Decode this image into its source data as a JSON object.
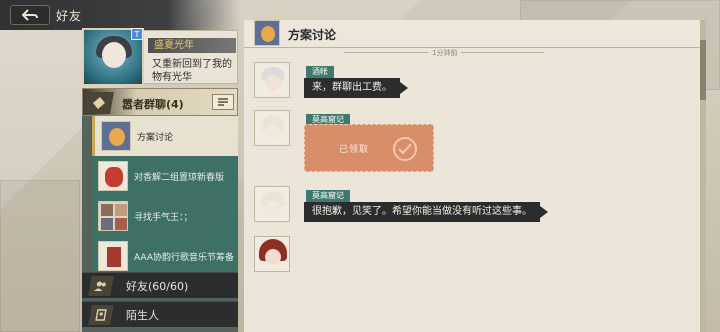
{
  "topbar": {
    "title": "好友",
    "back_icon": "back-arrow-icon"
  },
  "profile": {
    "level_badge": "T",
    "name": "盛夏光年",
    "signature": "又重新回到了我的物有光华"
  },
  "group": {
    "label": "嚣者群聊(4)"
  },
  "chat_list": [
    {
      "label": "方案讨论",
      "active": true
    },
    {
      "label": "对香解二组置琼新春版",
      "active": false
    },
    {
      "label": "寻找手气王：；",
      "active": false
    },
    {
      "label": "AAA协韵行歌音乐节筹备",
      "active": false
    }
  ],
  "friends": {
    "label": "好友(60/60)"
  },
  "strangers": {
    "label": "陌生人"
  },
  "chat": {
    "title": "方案讨论",
    "time_label": "1分钟前",
    "messages": [
      {
        "sender": "酒帐",
        "text": "来，群聊出工费。"
      },
      {
        "sender": "莫高窟记",
        "redpacket_label": "已领取"
      },
      {
        "sender": "莫高窟记",
        "text": "很抱歉，见笑了。希望你能当做没有听过这些事。"
      }
    ]
  },
  "colors": {
    "accent_gold": "#c9a852",
    "teal": "#3f7066",
    "redpacket": "#d98e6a",
    "bubble_dark": "#2b2c2d"
  }
}
